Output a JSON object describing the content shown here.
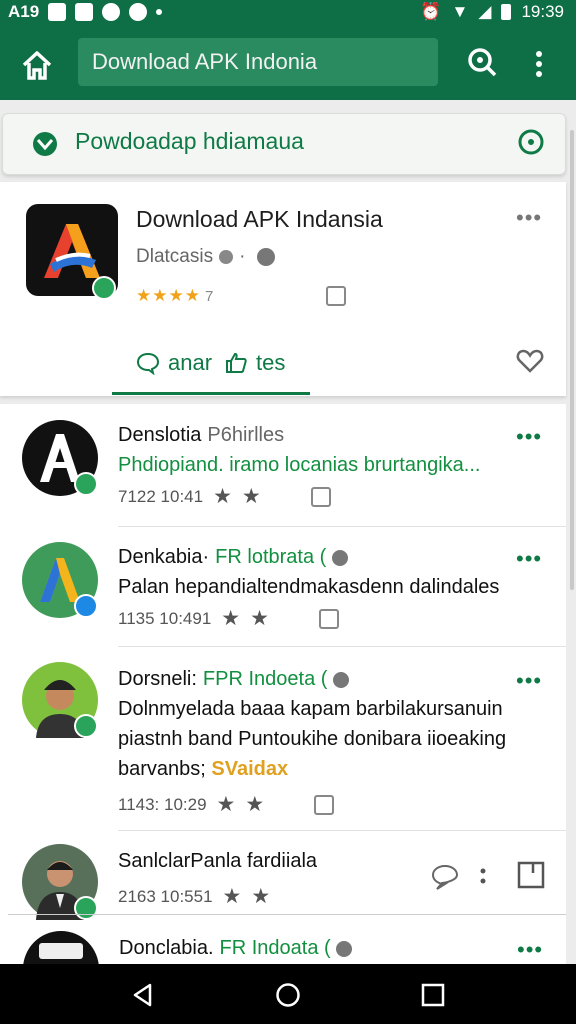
{
  "status_bar": {
    "left_text": "A19",
    "time": "19:39"
  },
  "app_bar": {
    "search_text": "Download APK Indonia"
  },
  "banner": {
    "text": "Powdoadap hdiamaua"
  },
  "app_card": {
    "title": "Download APK Indansia",
    "developer": "Dlatcasis",
    "rating_stars": "★★★★",
    "rating_count": "7",
    "tab_active": "anar",
    "tab_second": "tes"
  },
  "reviews": [
    {
      "name": "Denslotia",
      "source": "P6hirlles",
      "source_style": "gray",
      "body": "Phdiopiand. iramo locanias brurtangika...",
      "time": "7122 10:41"
    },
    {
      "name": "Denkabia·",
      "source": "FR lotbrata (",
      "source_style": "green",
      "body": "Palan hepandialtendmakasdenn dalindales",
      "time": "1135 10:491"
    },
    {
      "name": "Dorsneli:",
      "source": "FPR Indoeta (",
      "source_style": "green",
      "body": "Dolnmyelada baaa kapam barbilakursanuin piastnh band Puntoukihe donibara iioeaking barvanbs;",
      "body_highlight": "SVaidax",
      "time": "1143: 10:29"
    },
    {
      "name": "SanlclarPanla fardiiala",
      "source": "",
      "source_style": "gray",
      "body": "",
      "time": "2163 10:551"
    },
    {
      "name": "Donclabia.",
      "source": "FR Indoata (",
      "source_style": "green",
      "body": "",
      "time": ""
    }
  ],
  "colors": {
    "primary": "#0e6e46",
    "accent_green": "#0f7a45",
    "star": "#f0a31a"
  }
}
